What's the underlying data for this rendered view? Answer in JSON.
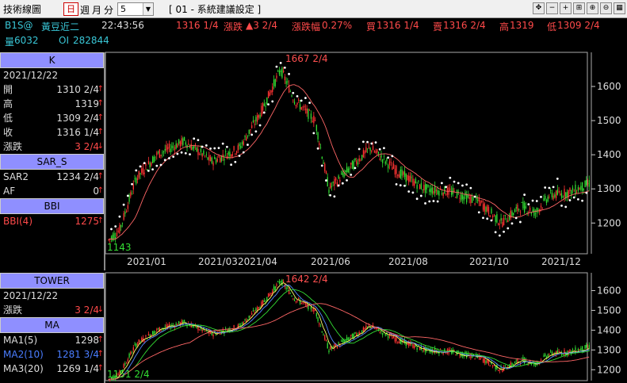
{
  "window": {
    "title": "技術線圖",
    "period_day": "日",
    "period_week": "週",
    "period_month": "月",
    "period_minute": "分",
    "minute_value": "5",
    "config_label": "[ 01 - 系統建議設定 ]"
  },
  "quote": {
    "symbol": "B1S@",
    "name": "黃豆近二",
    "time": "22:43:56",
    "last": "1316 1/4",
    "change_label": "漲跌",
    "change": "▲3 2/4",
    "change_pct_label": "漲跌幅",
    "change_pct": "0.27%",
    "bid_label": "買",
    "bid": "1316 1/4",
    "ask_label": "賣",
    "ask": "1316 2/4",
    "high_label": "高",
    "high": "1319",
    "low_label": "低",
    "low": "1309 2/4",
    "volume_label": "量",
    "volume": "6032",
    "oi_label": "OI",
    "oi": "282844"
  },
  "panel_k": {
    "header": "K",
    "date": "2021/12/22",
    "rows": [
      {
        "label": "開",
        "value": "1310 2/4"
      },
      {
        "label": "高",
        "value": "1319"
      },
      {
        "label": "低",
        "value": "1309 2/4"
      },
      {
        "label": "收",
        "value": "1316 1/4"
      },
      {
        "label": "漲跌",
        "value": "3 2/4"
      }
    ]
  },
  "panel_sar": {
    "header": "SAR_S",
    "rows": [
      {
        "label": "SAR2",
        "value": "1234 2/4"
      },
      {
        "label": "AF",
        "value": "0"
      }
    ]
  },
  "panel_bbi": {
    "header": "BBI",
    "rows": [
      {
        "label": "BBI(4)",
        "value": "1275"
      }
    ]
  },
  "panel_tower": {
    "header": "TOWER",
    "date": "2021/12/22",
    "rows": [
      {
        "label": "漲跌",
        "value": "3 2/4"
      }
    ]
  },
  "panel_ma": {
    "header": "MA",
    "rows": [
      {
        "label": "MA1(5)",
        "value": "1298"
      },
      {
        "label": "MA2(10)",
        "value": "1281 3/4"
      },
      {
        "label": "MA3(20)",
        "value": "1269 1/4"
      }
    ]
  },
  "colors": {
    "up": "#ff3333",
    "down": "#33dd33",
    "sar": "#ffffff",
    "axis": "#cccccc",
    "ma5": "#ffff66",
    "ma10": "#5588ff",
    "ma20": "#33dd33",
    "ma60": "#ff6666"
  },
  "chart_data": [
    {
      "type": "candlestick",
      "name": "K",
      "x_ticks": [
        "2021/01",
        "2021/03",
        "2021/04",
        "2021/06",
        "2021/08",
        "2021/10",
        "2021/12"
      ],
      "y_ticks": [
        1200,
        1300,
        1400,
        1500,
        1600
      ],
      "ylim": [
        1110,
        1700
      ],
      "annotations": {
        "high_label": "1667 2/4",
        "low_label": "1143"
      }
    },
    {
      "type": "candlestick",
      "name": "TOWER / MA",
      "y_ticks": [
        1200,
        1300,
        1400,
        1500,
        1600
      ],
      "ylim": [
        1145,
        1690
      ],
      "annotations": {
        "high_label": "1642 2/4",
        "low_label": "1151 2/4"
      }
    }
  ]
}
